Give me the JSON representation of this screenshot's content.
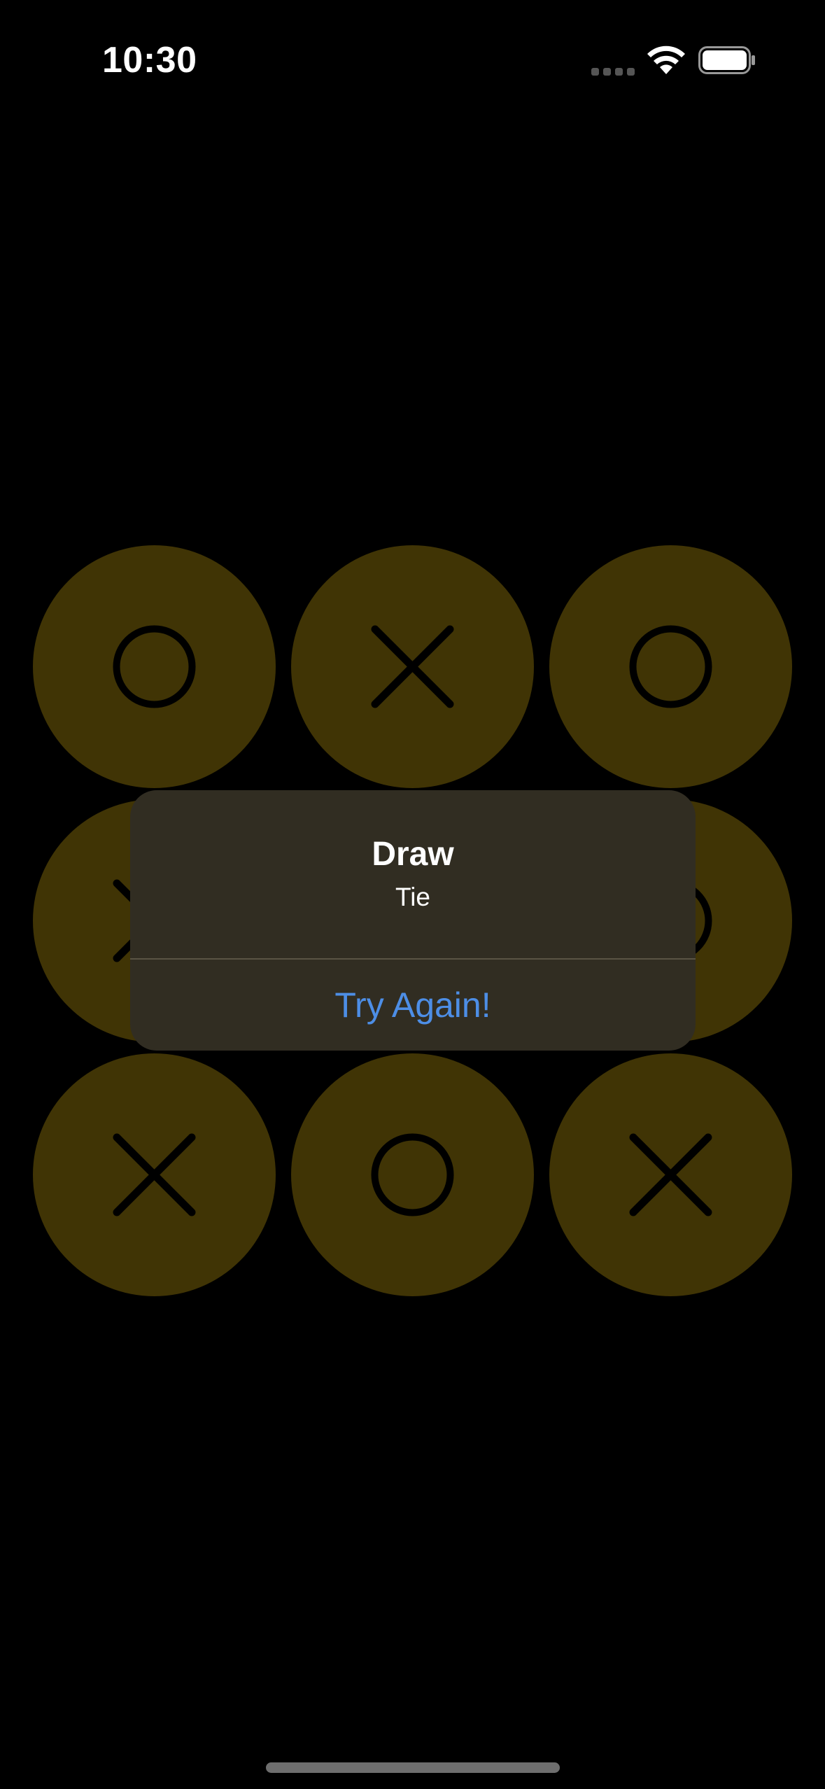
{
  "status_bar": {
    "time": "10:30",
    "signal_icon": "cellular-signal-icon",
    "wifi_icon": "wifi-icon",
    "battery_icon": "battery-icon"
  },
  "board": {
    "cells": [
      "O",
      "X",
      "O",
      "X",
      "",
      "O",
      "X",
      "O",
      "X"
    ],
    "cell_color": "#403405",
    "mark_color": "#000000"
  },
  "alert": {
    "title": "Draw",
    "message": "Tie",
    "button_label": "Try Again!",
    "button_color": "#4d8ee6"
  }
}
